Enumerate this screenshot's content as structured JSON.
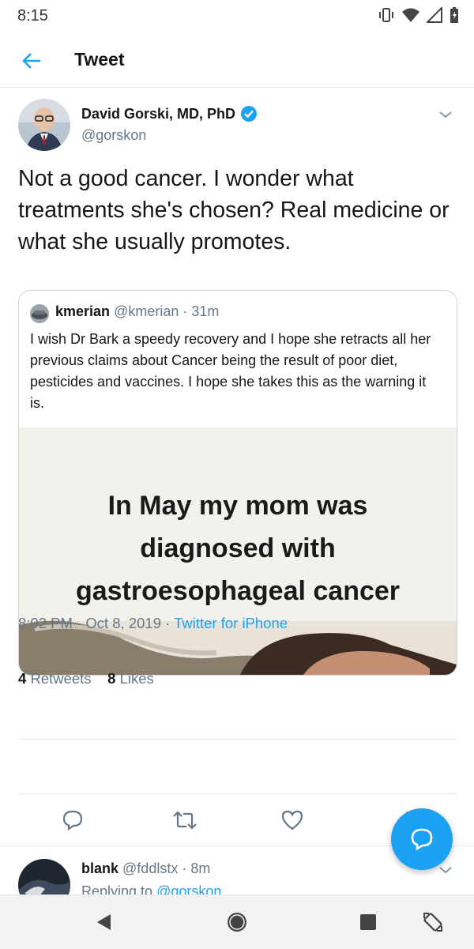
{
  "status_bar": {
    "time": "8:15"
  },
  "app_bar": {
    "title": "Tweet",
    "back_icon": "back-arrow-icon"
  },
  "tweet": {
    "author_name": "David Gorski, MD, PhD",
    "author_handle": "@gorskon",
    "verified": true,
    "text": "Not a good cancer. I wonder what treatments she's chosen? Real medicine or what she usually promotes.",
    "quote": {
      "name": "kmerian",
      "handle": "@kmerian",
      "time": "· 31m",
      "text": "I wish Dr Bark a speedy recovery and I hope she retracts all her previous claims about Cancer being the result of poor diet, pesticides and vaccines. I hope she takes this as the warning it is.",
      "image_caption_lines": [
        "In May my mom was",
        "diagnosed with",
        "gastroesophageal cancer"
      ]
    },
    "timestamp": "8:02 PM · Oct 8, 2019 · ",
    "source": "Twitter for iPhone",
    "retweets_count": "4",
    "retweets_label": "Retweets",
    "likes_count": "8",
    "likes_label": "Likes"
  },
  "reply": {
    "name": "blank",
    "handle": "@fddlstx",
    "time": "· 8m",
    "replying_prefix": "Replying to ",
    "replying_to": "@gorskon"
  },
  "colors": {
    "accent": "#1da1f2",
    "text": "#14171a",
    "secondary": "#657786"
  }
}
